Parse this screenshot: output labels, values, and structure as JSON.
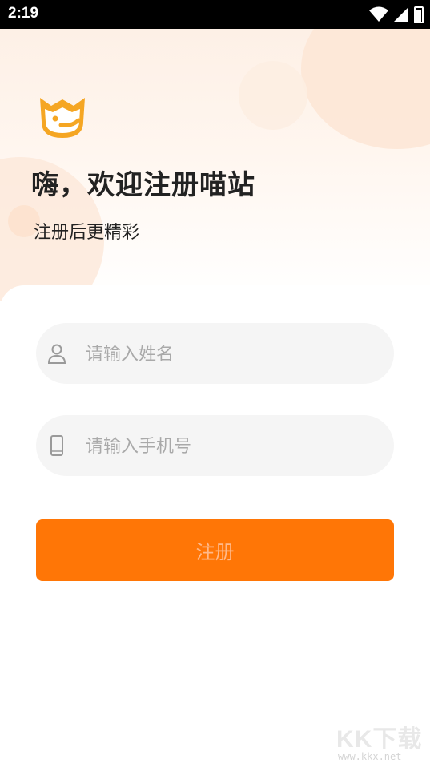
{
  "status_bar": {
    "time": "2:19",
    "icons": [
      "wifi-icon",
      "signal-icon",
      "battery-icon"
    ]
  },
  "header": {
    "title": "嗨，欢迎注册喵站",
    "subtitle": "注册后更精彩",
    "logo_icon": "cat-face-logo"
  },
  "form": {
    "name": {
      "placeholder": "请输入姓名",
      "value": "",
      "icon": "user-icon"
    },
    "phone": {
      "placeholder": "请输入手机号",
      "value": "",
      "icon": "phone-icon"
    },
    "submit_label": "注册"
  },
  "watermark": {
    "text": "KK下载",
    "url": "www.kkx.net"
  },
  "colors": {
    "accent": "#ff7606",
    "logo": "#f5a623",
    "input_bg": "#f5f5f5"
  }
}
